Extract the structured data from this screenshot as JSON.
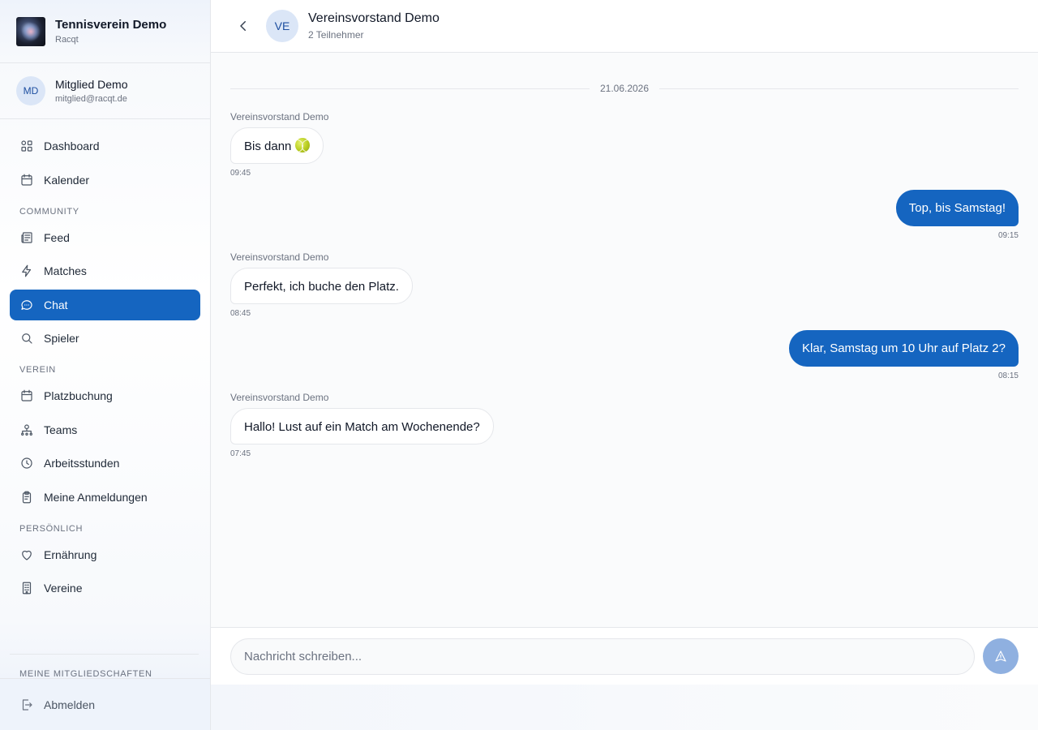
{
  "brand": {
    "title": "Tennisverein Demo",
    "subtitle": "Racqt"
  },
  "user": {
    "initials": "MD",
    "name": "Mitglied Demo",
    "email": "mitglied@racqt.de"
  },
  "nav": {
    "dashboard": "Dashboard",
    "kalender": "Kalender",
    "community_label": "COMMUNITY",
    "feed": "Feed",
    "matches": "Matches",
    "chat": "Chat",
    "spieler": "Spieler",
    "verein_label": "VEREIN",
    "platzbuchung": "Platzbuchung",
    "teams": "Teams",
    "arbeitsstunden": "Arbeitsstunden",
    "anmeldungen": "Meine Anmeldungen",
    "persoenlich_label": "PERSÖNLICH",
    "ernaehrung": "Ernährung",
    "vereine": "Vereine",
    "mitgliedschaften_label": "MEINE MITGLIEDSCHAFTEN",
    "abmelden": "Abmelden"
  },
  "chat": {
    "avatar_initials": "VE",
    "title": "Vereinsvorstand Demo",
    "participants": "2 Teilnehmer",
    "date": "21.06.2026",
    "messages": [
      {
        "direction": "in",
        "sender": "Vereinsvorstand Demo",
        "text": "Bis dann",
        "emoji": "tennis-ball",
        "time": "09:45"
      },
      {
        "direction": "out",
        "text": "Top, bis Samstag!",
        "time": "09:15"
      },
      {
        "direction": "in",
        "sender": "Vereinsvorstand Demo",
        "text": "Perfekt, ich buche den Platz.",
        "time": "08:45"
      },
      {
        "direction": "out",
        "text": "Klar, Samstag um 10 Uhr auf Platz 2?",
        "time": "08:15"
      },
      {
        "direction": "in",
        "sender": "Vereinsvorstand Demo",
        "text": "Hallo! Lust auf ein Match am Wochenende?",
        "time": "07:45"
      }
    ],
    "input_placeholder": "Nachricht schreiben..."
  },
  "colors": {
    "accent": "#1565c0",
    "send_disabled": "#8fb0e0",
    "avatar_bg": "#dbe6f7"
  }
}
